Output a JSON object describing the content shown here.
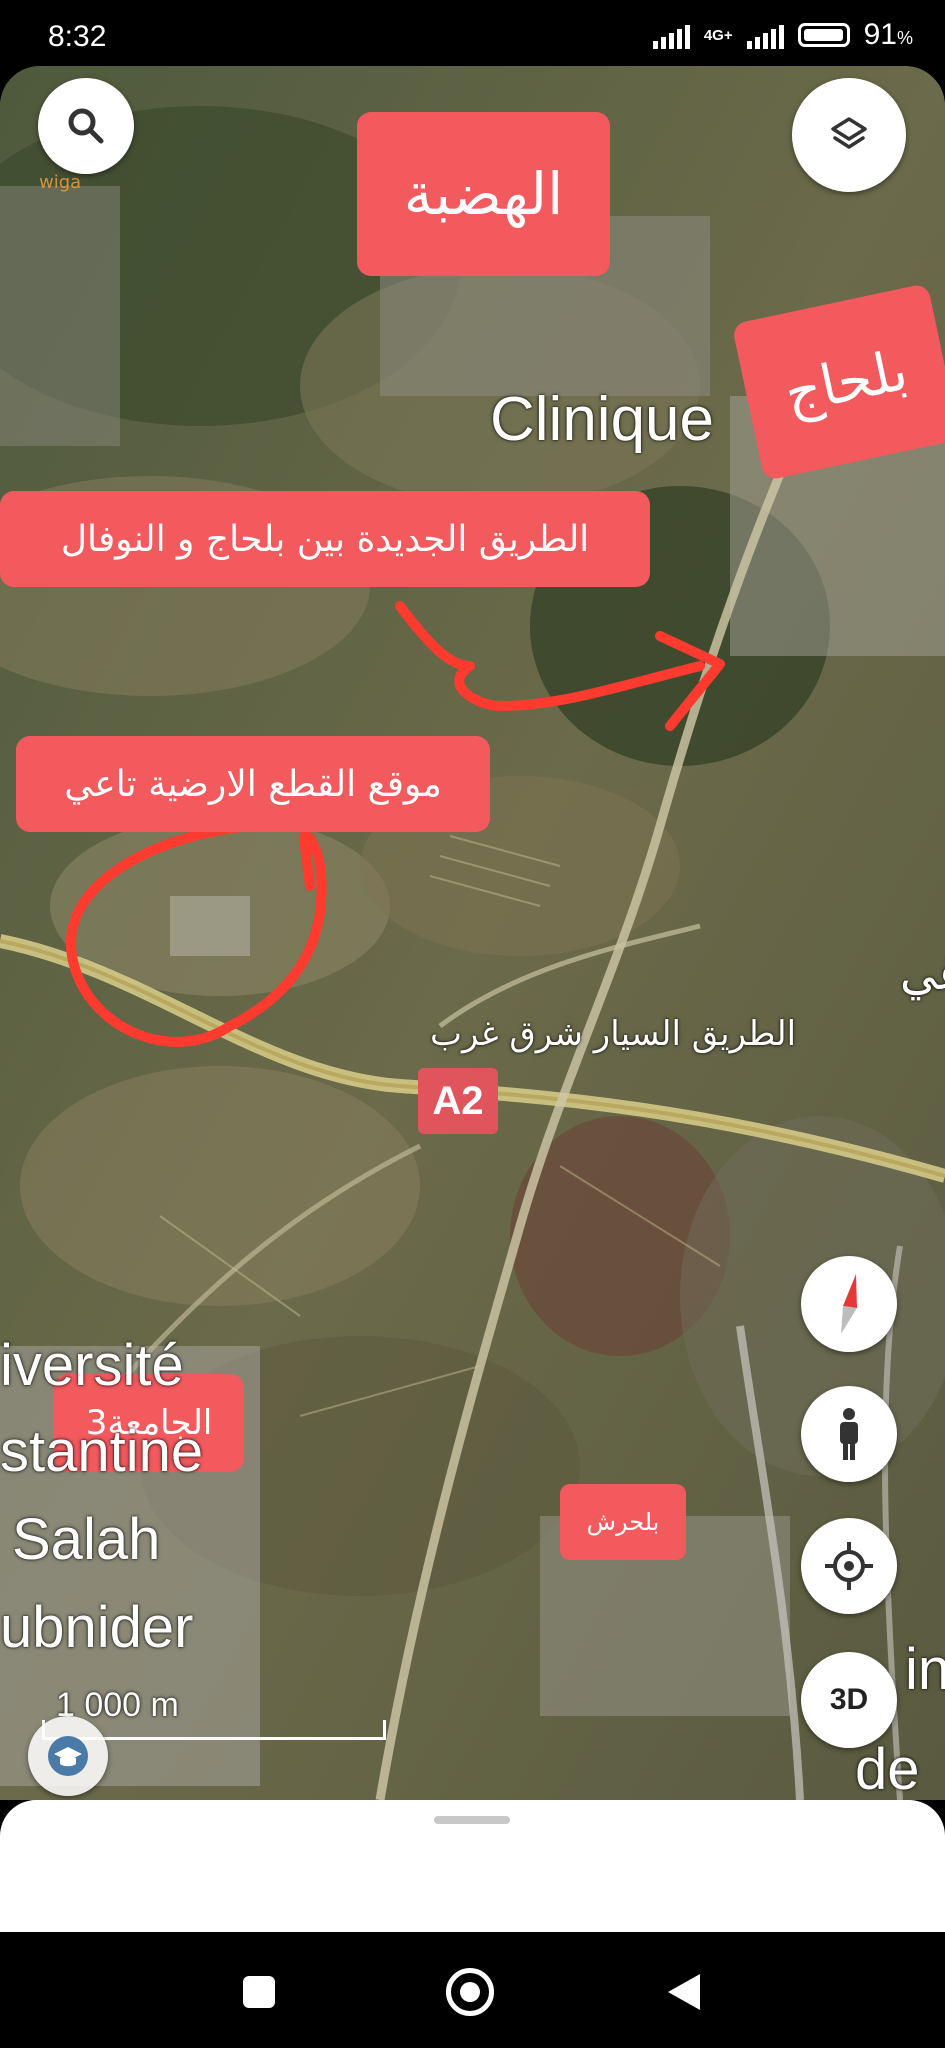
{
  "status_bar": {
    "time": "8:32",
    "network": "4G+",
    "battery": "91",
    "battery_unit": "%",
    "battery_level": 0.91
  },
  "watermark": {
    "text": "wiga.سوية"
  },
  "map": {
    "controls": {
      "search_icon": "search-icon",
      "layers_icon": "layers-icon",
      "compass_icon": "compass-icon",
      "street_view_icon": "pegman-icon",
      "location_icon": "crosshair-icon",
      "three_d_label": "3D"
    },
    "labels": {
      "hadaba": "الهضبة",
      "belhadj": "بلحاج",
      "new_road": "الطريق الجديدة بين بلحاج و النوفال",
      "my_plot": "موقع القطع الارضية تاعي",
      "university": "الجامعة3",
      "belharch": "بلحرش"
    },
    "map_text": {
      "clinique": "Clinique",
      "highway": "الطريق السيار شرق غرب",
      "highway_shield": "A2",
      "partial_right": "غي",
      "univ_line1": "iversité",
      "univ_line2": "stantine",
      "univ_line3": "Salah",
      "univ_line4": "ubnider",
      "partial_in": "in",
      "partial_de": "de"
    },
    "scale": {
      "label": "1 000 m"
    },
    "annotation_color": "#ff3b30",
    "label_color": "#f25a5e"
  }
}
